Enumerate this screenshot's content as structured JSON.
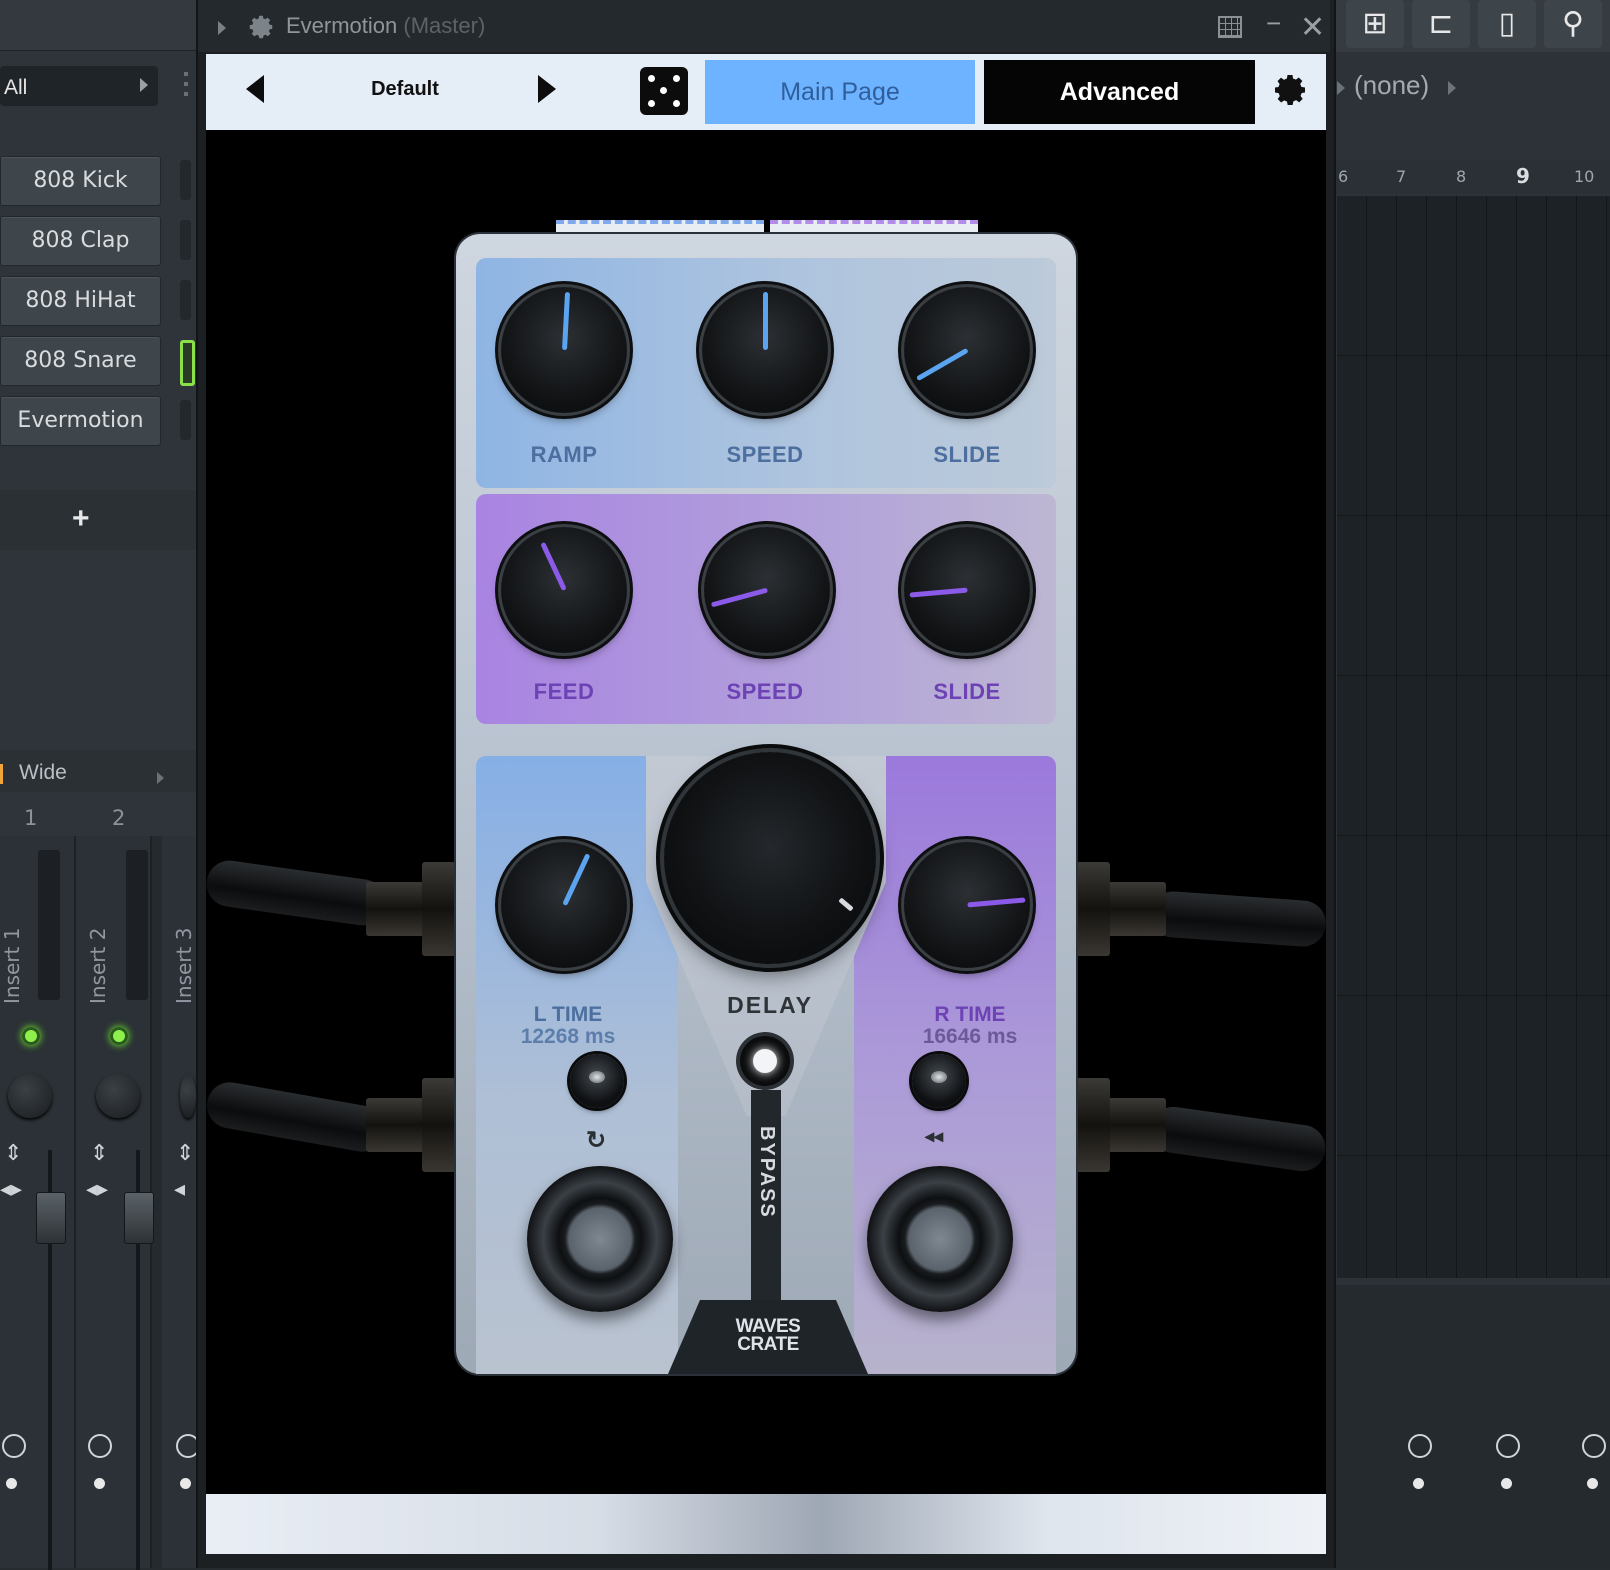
{
  "left_panel": {
    "filter": "All",
    "channels": [
      "808 Kick",
      "808 Clap",
      "808 HiHat",
      "808 Snare",
      "Evermotion"
    ],
    "add_label": "+",
    "mixer_preset": "Wide",
    "track_numbers": [
      "1",
      "2"
    ],
    "inserts": [
      "Insert 1",
      "Insert 2",
      "Insert 3"
    ]
  },
  "right_panel": {
    "pattern": "(none)",
    "ruler": [
      "6",
      "7",
      "8",
      "9",
      "10"
    ]
  },
  "window": {
    "title": "Evermotion",
    "subtitle": "(Master)",
    "minimize": "−",
    "close": "✕"
  },
  "plugin": {
    "preset": "Default",
    "tabs": {
      "main": "Main Page",
      "advanced": "Advanced"
    },
    "active_tab": "Main Page",
    "colors": {
      "blue_accent": "#6db3ff",
      "knob_blue": "#5ba4f0",
      "knob_purple": "#8c5ae8"
    },
    "pitch_knobs": {
      "ramp": "RAMP",
      "speed": "SPEED",
      "slide": "SLIDE"
    },
    "mod_knobs": {
      "feed": "FEED",
      "speed": "SPEED",
      "slide": "SLIDE"
    },
    "delay": {
      "label": "DELAY",
      "l_time_label": "L TIME",
      "l_time_value": "12268 ms",
      "r_time_label": "R TIME",
      "r_time_value": "16646 ms",
      "bypass": "BYPASS",
      "loop_icon": "↻",
      "reverse_icon": "◂◂"
    },
    "brand": {
      "line1": "WAVES",
      "line2": "CRATE"
    }
  }
}
